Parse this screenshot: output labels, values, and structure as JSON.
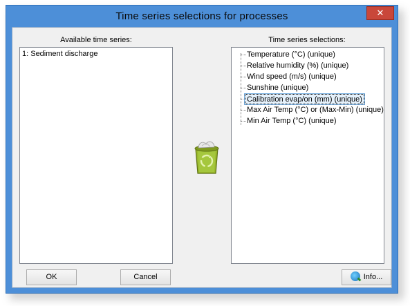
{
  "window": {
    "title": "Time series selections for processes",
    "close_glyph": "✕"
  },
  "left_panel": {
    "label": "Available time series:",
    "items": [
      "1: Sediment discharge"
    ]
  },
  "right_panel": {
    "label": "Time series selections:",
    "items": [
      "Temperature (°C) (unique)",
      "Relative humidity (%) (unique)",
      "Wind speed (m/s) (unique)",
      "Sunshine (unique)",
      "Calibration evap/on (mm) (unique)",
      "Max Air Temp (°C) or (Max-Min) (unique)",
      "Min Air Temp (°C) (unique)"
    ],
    "selected_index": 4
  },
  "center": {
    "icon": "recycle-bin-icon"
  },
  "buttons": {
    "ok": "OK",
    "cancel": "Cancel",
    "info": "Info..."
  },
  "colors": {
    "window_frame": "#4d8fd8",
    "close_button": "#c9473a",
    "client_bg": "#f0f0f0",
    "selection_bg": "#e5f1fb",
    "recycle_bin": "#9ab82c"
  }
}
